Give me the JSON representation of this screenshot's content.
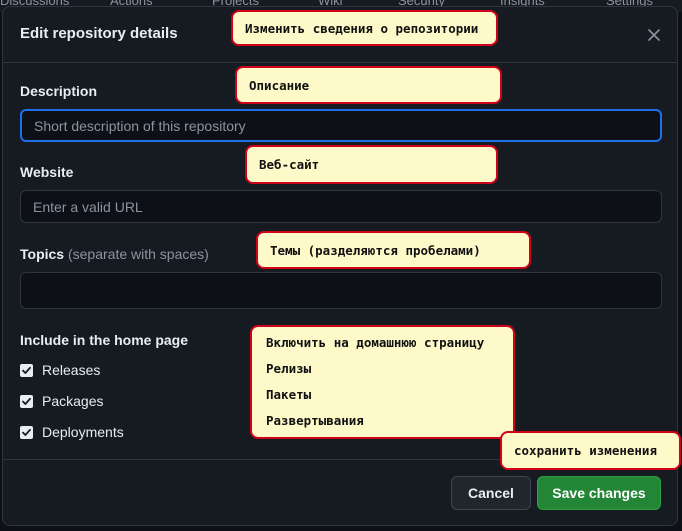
{
  "background_nav": [
    "Discussions",
    "Actions",
    "Projects",
    "Wiki",
    "Security",
    "Insights",
    "Settings"
  ],
  "dialog": {
    "title": "Edit repository details",
    "close_icon": "close-icon"
  },
  "form": {
    "description": {
      "label": "Description",
      "value": "",
      "placeholder": "Short description of this repository"
    },
    "website": {
      "label": "Website",
      "value": "",
      "placeholder": "Enter a valid URL"
    },
    "topics": {
      "label": "Topics",
      "hint": "(separate with spaces)",
      "value": ""
    },
    "home_page": {
      "label": "Include in the home page",
      "items": [
        {
          "label": "Releases",
          "checked": true
        },
        {
          "label": "Packages",
          "checked": true
        },
        {
          "label": "Deployments",
          "checked": true
        }
      ]
    }
  },
  "footer": {
    "cancel_label": "Cancel",
    "save_label": "Save changes"
  },
  "annotations": {
    "title": "Изменить сведения о репозитории",
    "description": "Описание",
    "website": "Веб-сайт",
    "topics": "Темы (разделяются пробелами)",
    "home_page": [
      "Включить на домашнюю страницу",
      "Релизы",
      "Пакеты",
      "Развертывания"
    ],
    "save": "сохранить изменения"
  },
  "colors": {
    "dialog_bg": "#161b22",
    "input_bg": "#0d1117",
    "focus_border": "#1f6feb",
    "save_button": "#238636",
    "annotation_bg": "#fdf9c9",
    "annotation_border": "#d0021b"
  }
}
